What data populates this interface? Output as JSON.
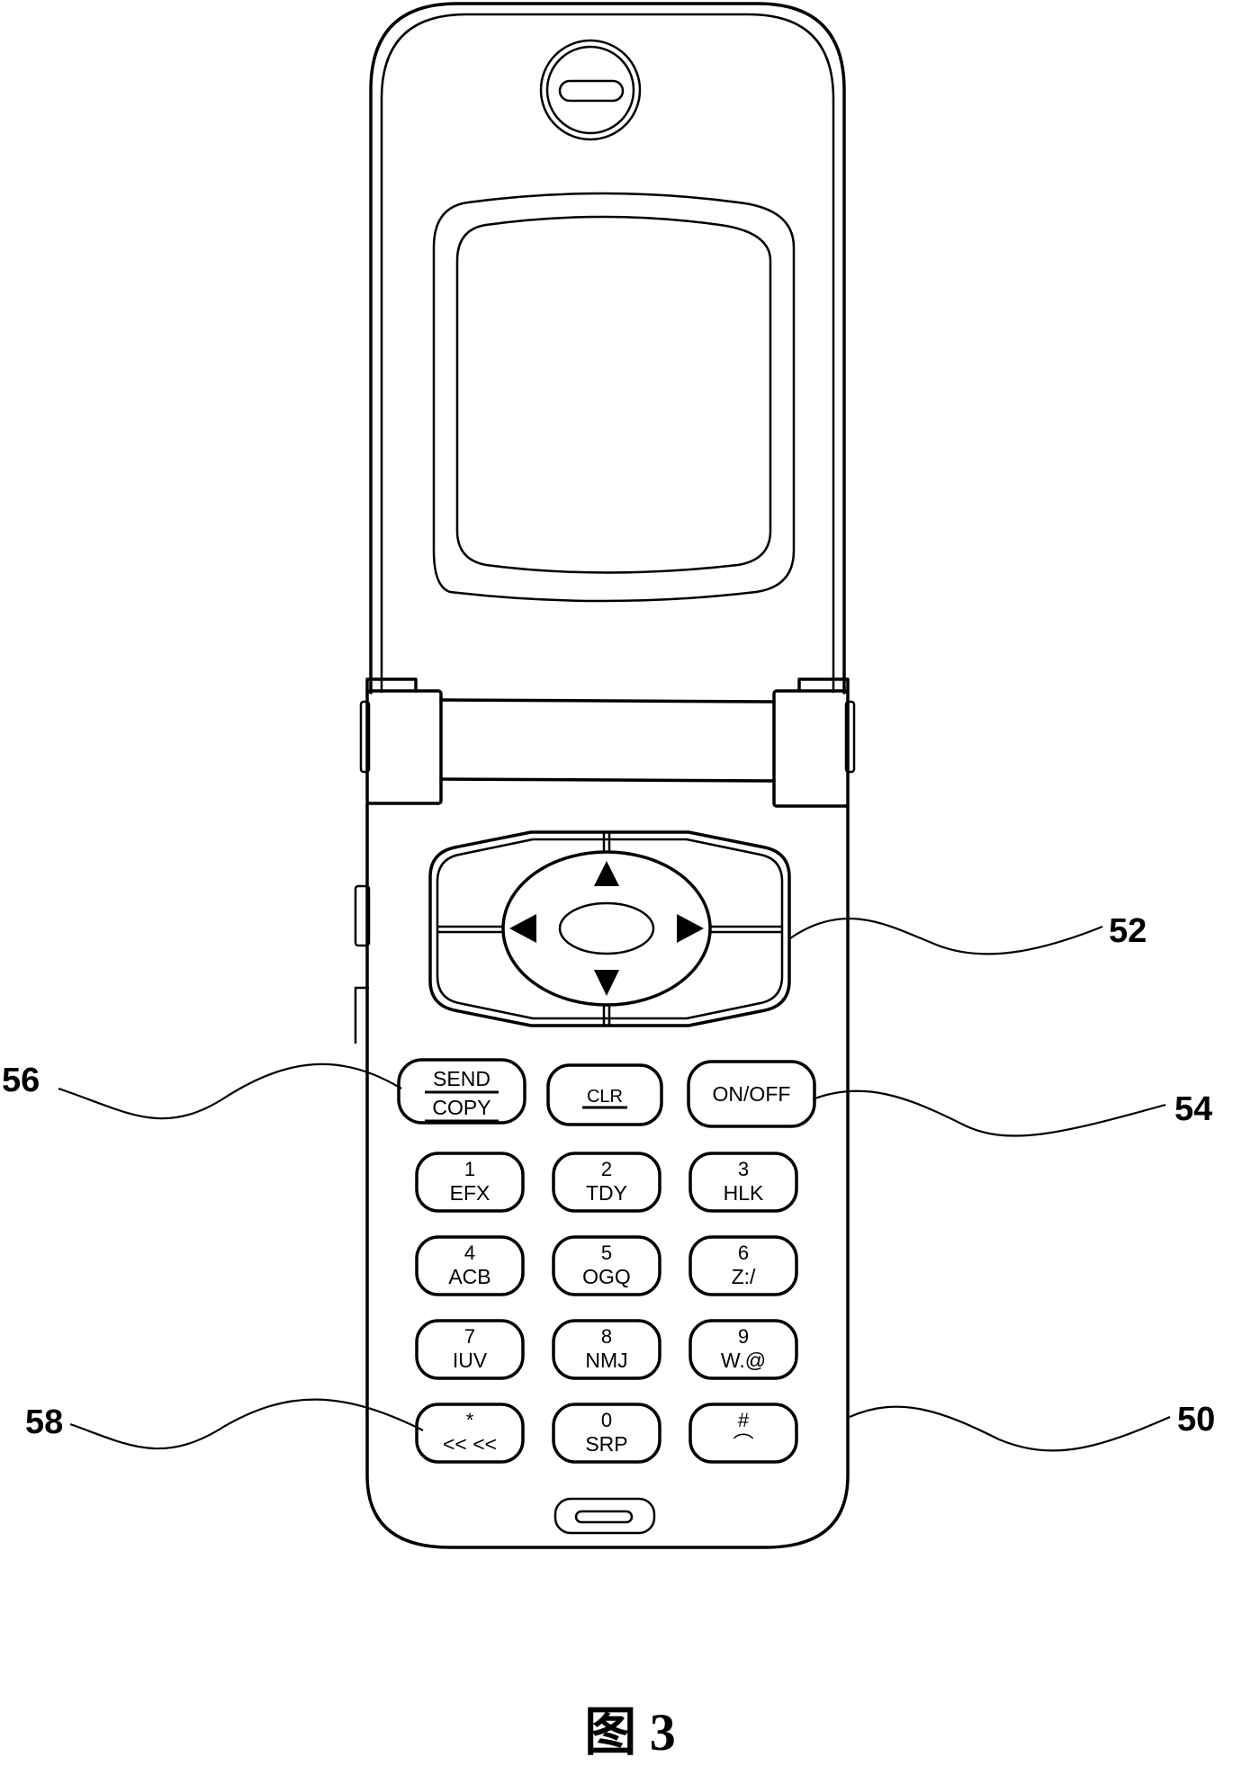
{
  "figure": {
    "caption": "图 3",
    "colors": {
      "line": "#000000",
      "background": "#ffffff"
    }
  },
  "reference_labels": {
    "body": "50",
    "nav_key": "52",
    "power_key": "54",
    "send_key": "56",
    "star_key": "58"
  },
  "function_keys": {
    "send": {
      "line1": "SEND",
      "line2": "COPY"
    },
    "clear": {
      "label": "CLR"
    },
    "power": {
      "label": "ON/OFF"
    }
  },
  "keypad": [
    {
      "digit": "1",
      "letters": "EFX"
    },
    {
      "digit": "2",
      "letters": "TDY"
    },
    {
      "digit": "3",
      "letters": "HLK"
    },
    {
      "digit": "4",
      "letters": "ACB"
    },
    {
      "digit": "5",
      "letters": "OGQ"
    },
    {
      "digit": "6",
      "letters": "Z:/"
    },
    {
      "digit": "7",
      "letters": "IUV"
    },
    {
      "digit": "8",
      "letters": "NMJ"
    },
    {
      "digit": "9",
      "letters": "W.@"
    },
    {
      "digit": "*",
      "letters": "<< <<"
    },
    {
      "digit": "0",
      "letters": "SRP"
    },
    {
      "digit": "#",
      "letters": "⌒"
    }
  ],
  "icons": {
    "nav_up": "arrow-up",
    "nav_down": "arrow-down",
    "nav_left": "arrow-left",
    "nav_right": "arrow-right"
  }
}
